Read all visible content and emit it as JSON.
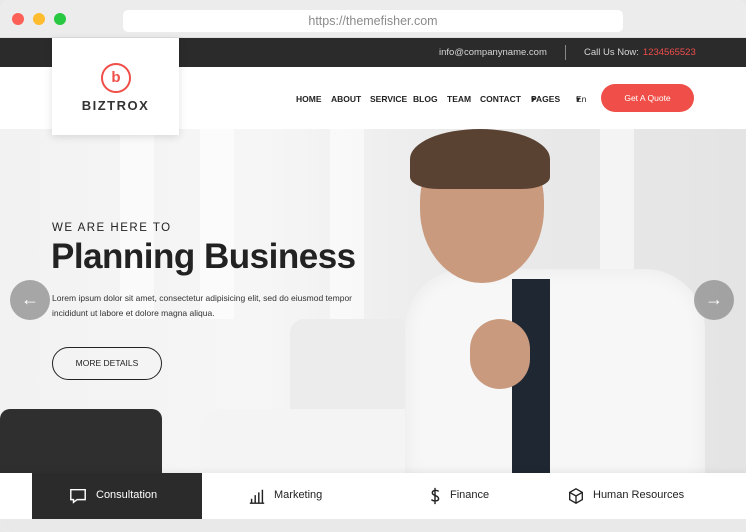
{
  "browser": {
    "url": "https://themefisher.com"
  },
  "topbar": {
    "email": "info@companyname.com",
    "call_label": "Call Us Now:",
    "call_number": "1234565523"
  },
  "brand": {
    "mark": "b",
    "name": "BIZTROX"
  },
  "nav": {
    "items": [
      "HOME",
      "ABOUT",
      "SERVICE",
      "BLOG",
      "TEAM",
      "CONTACT",
      "PAGES"
    ],
    "language": "En",
    "cta": "Get A Quote"
  },
  "hero": {
    "eyebrow": "WE ARE HERE TO",
    "title": "Planning Business",
    "description": "Lorem ipsum dolor sit amet, consectetur adipisicing elit, sed do eiusmod tempor incididunt ut labore et dolore magna aliqua.",
    "button": "MORE DETAILS"
  },
  "services": [
    {
      "label": "Consultation",
      "icon": "chat-icon"
    },
    {
      "label": "Marketing",
      "icon": "bar-chart-icon"
    },
    {
      "label": "Finance",
      "icon": "dollar-icon"
    },
    {
      "label": "Human Resources",
      "icon": "cube-icon"
    }
  ],
  "colors": {
    "accent": "#ef4f48",
    "dark": "#2b2b2b"
  }
}
